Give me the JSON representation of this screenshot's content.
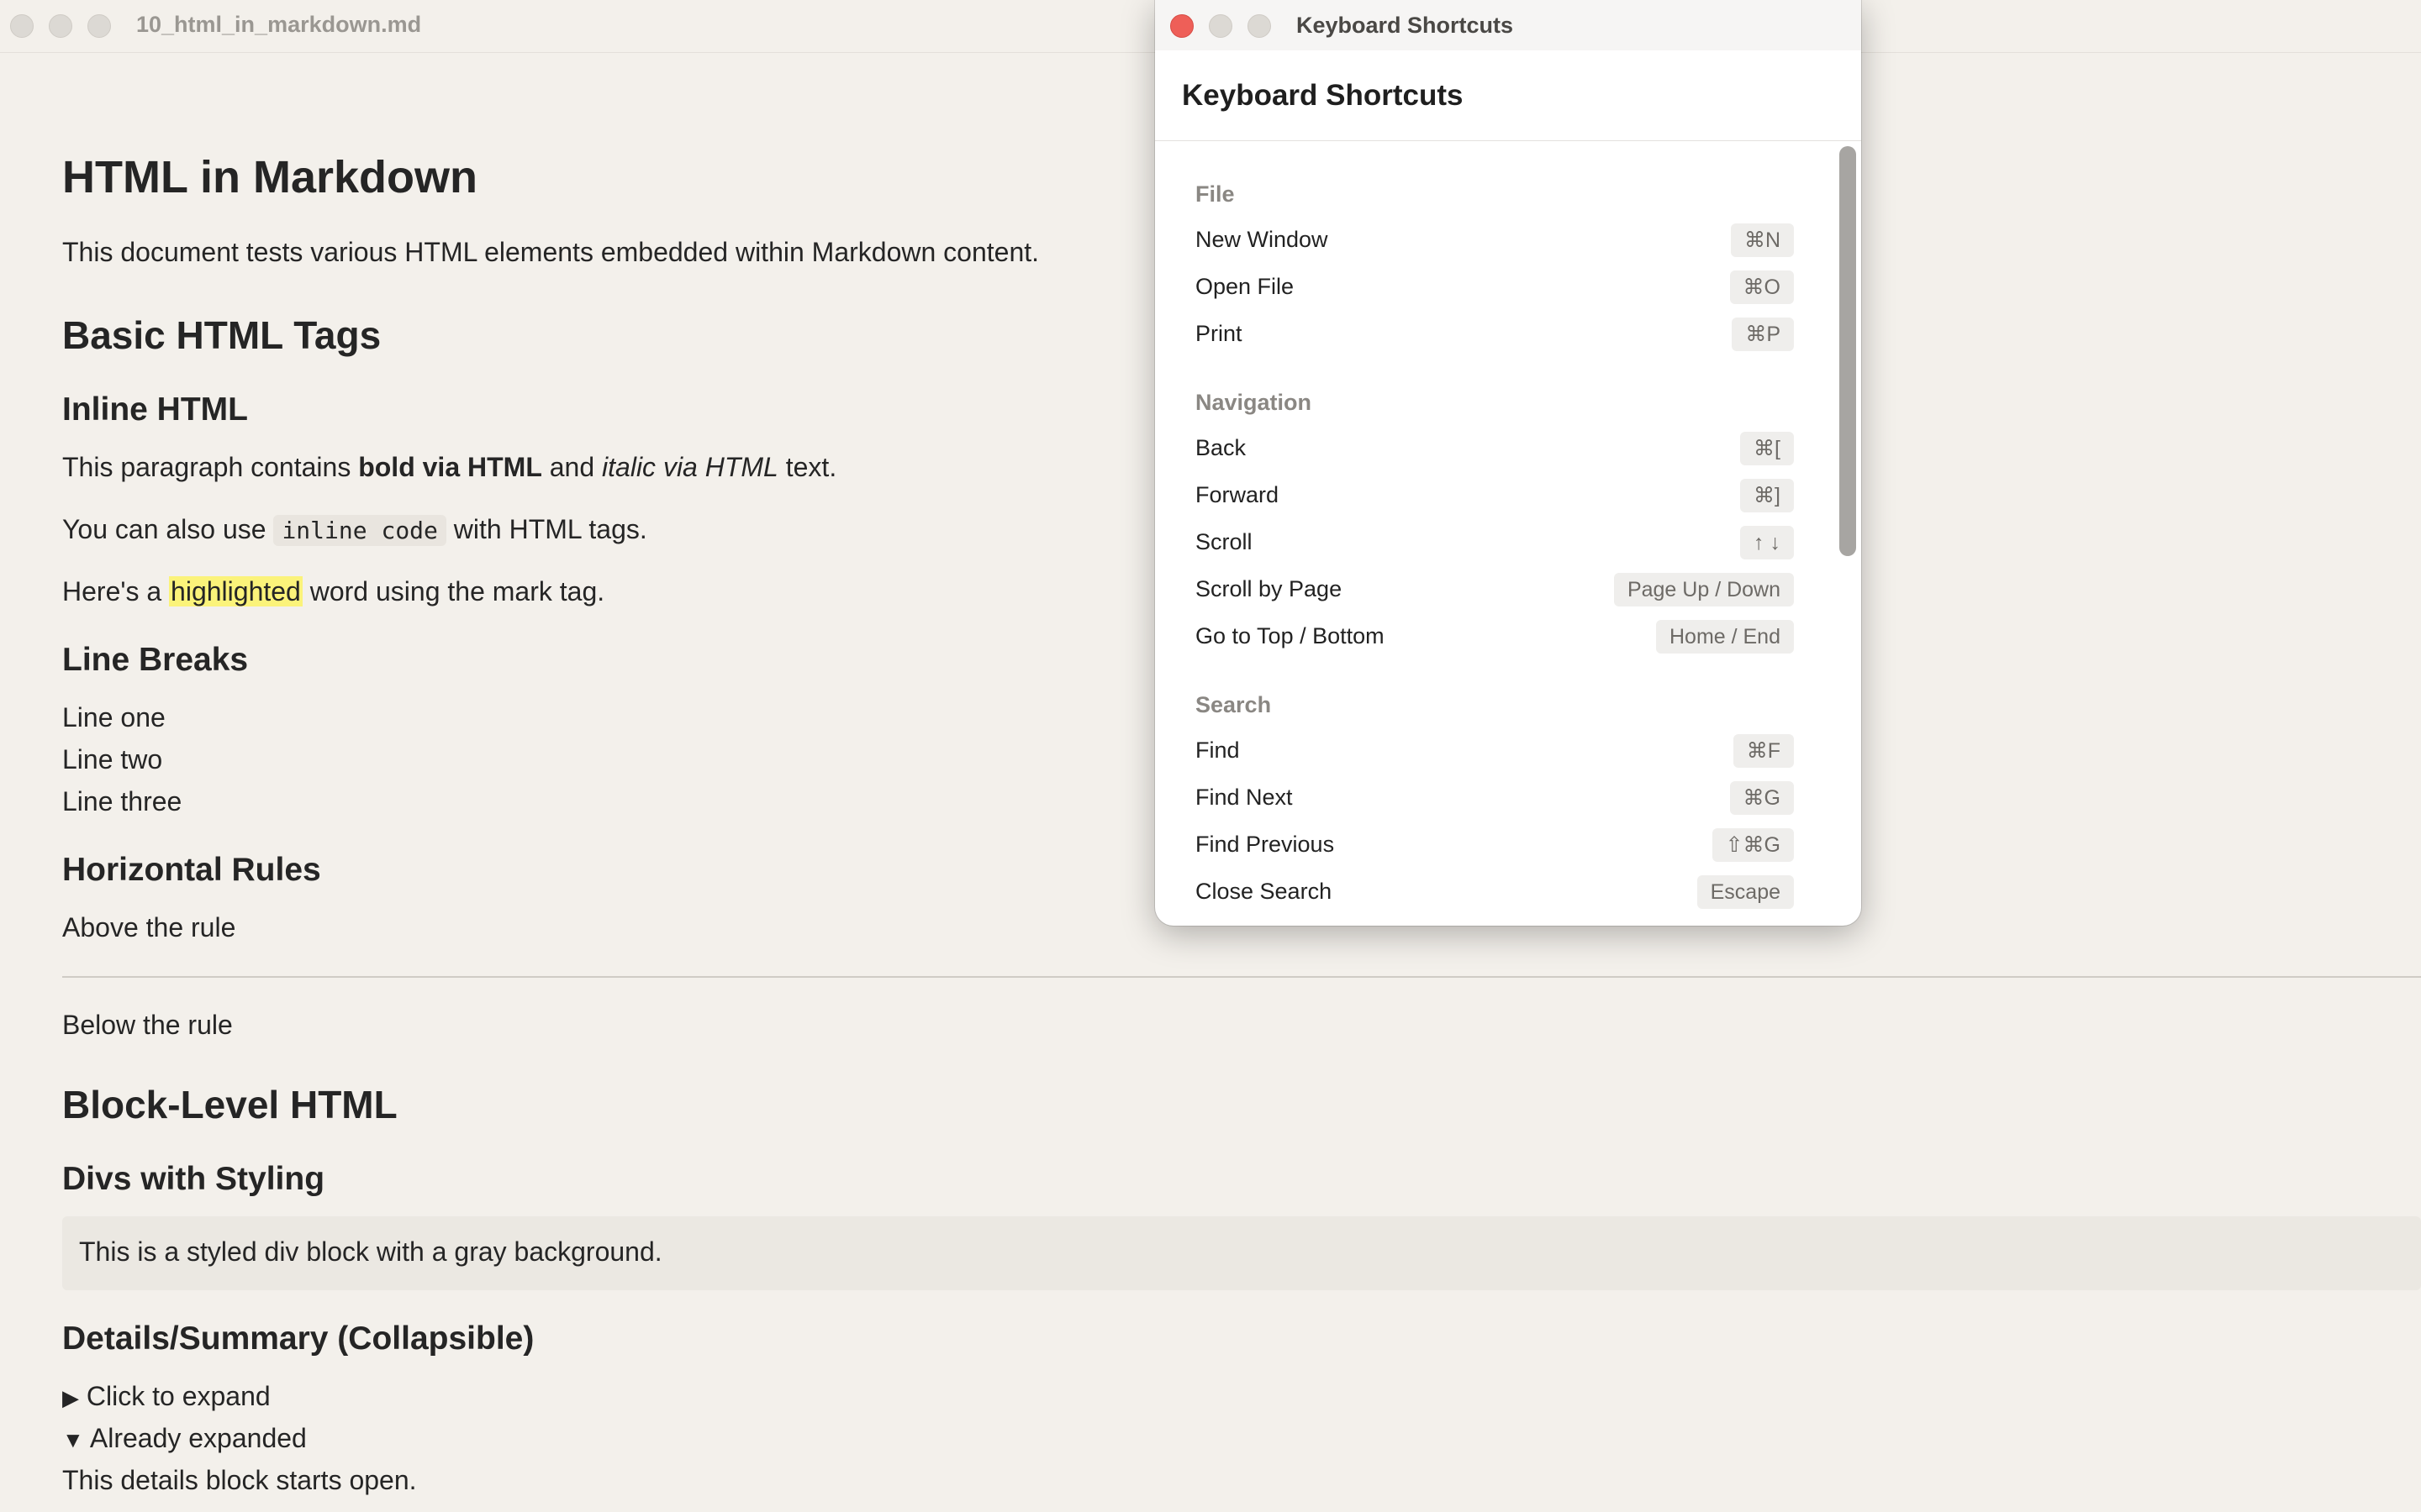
{
  "main_window": {
    "title": "10_html_in_markdown.md"
  },
  "doc": {
    "h1": "HTML in Markdown",
    "intro": "This document tests various HTML elements embedded within Markdown content.",
    "basic_tags": "Basic HTML Tags",
    "inline_html": "Inline HTML",
    "inline_p1": {
      "a": "This paragraph contains ",
      "bold": "bold via HTML",
      "b": " and ",
      "italic": "italic via HTML",
      "c": " text."
    },
    "inline_p2": {
      "a": "You can also use ",
      "code": "inline code",
      "b": " with HTML tags."
    },
    "inline_p3": {
      "a": "Here's a ",
      "mark": "highlighted",
      "b": " word using the mark tag."
    },
    "line_breaks": "Line Breaks",
    "lines": [
      "Line one",
      "Line two",
      "Line three"
    ],
    "horizontal_rules": "Horizontal Rules",
    "above_rule": "Above the rule",
    "below_rule": "Below the rule",
    "block_level": "Block-Level HTML",
    "divs_styling": "Divs with Styling",
    "styled_div": "This is a styled div block with a gray background.",
    "details_heading": "Details/Summary (Collapsible)",
    "details_collapsed": "Click to expand",
    "details_expanded": "Already expanded",
    "details_body": "This details block starts open.",
    "glyph_collapsed": "▶",
    "glyph_expanded": "▼"
  },
  "shortcuts": {
    "window_title": "Keyboard Shortcuts",
    "heading": "Keyboard Shortcuts",
    "sections": [
      {
        "title": "File",
        "items": [
          {
            "label": "New Window",
            "key": "⌘N"
          },
          {
            "label": "Open File",
            "key": "⌘O"
          },
          {
            "label": "Print",
            "key": "⌘P"
          }
        ]
      },
      {
        "title": "Navigation",
        "items": [
          {
            "label": "Back",
            "key": "⌘["
          },
          {
            "label": "Forward",
            "key": "⌘]"
          },
          {
            "label": "Scroll",
            "key": "↑ ↓"
          },
          {
            "label": "Scroll by Page",
            "key": "Page Up / Down"
          },
          {
            "label": "Go to Top / Bottom",
            "key": "Home / End"
          }
        ]
      },
      {
        "title": "Search",
        "items": [
          {
            "label": "Find",
            "key": "⌘F"
          },
          {
            "label": "Find Next",
            "key": "⌘G"
          },
          {
            "label": "Find Previous",
            "key": "⇧⌘G"
          },
          {
            "label": "Close Search",
            "key": "Escape"
          }
        ]
      }
    ]
  }
}
